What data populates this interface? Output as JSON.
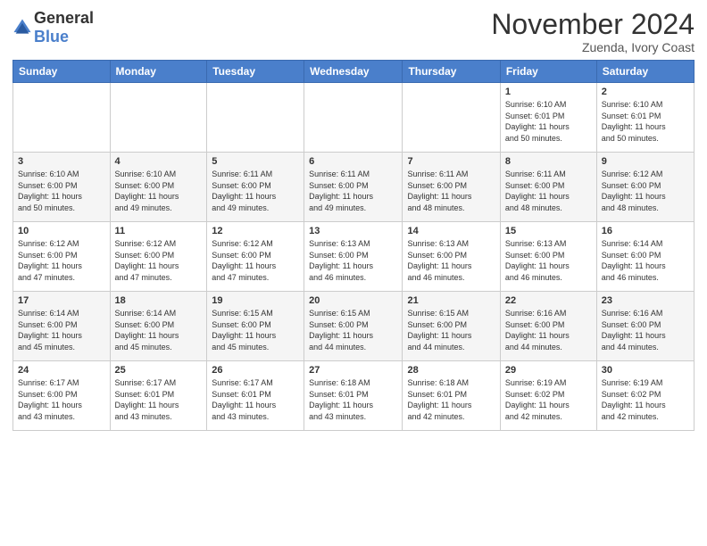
{
  "logo": {
    "general": "General",
    "blue": "Blue"
  },
  "header": {
    "month": "November 2024",
    "location": "Zuenda, Ivory Coast"
  },
  "weekdays": [
    "Sunday",
    "Monday",
    "Tuesday",
    "Wednesday",
    "Thursday",
    "Friday",
    "Saturday"
  ],
  "weeks": [
    [
      {
        "day": "",
        "info": ""
      },
      {
        "day": "",
        "info": ""
      },
      {
        "day": "",
        "info": ""
      },
      {
        "day": "",
        "info": ""
      },
      {
        "day": "",
        "info": ""
      },
      {
        "day": "1",
        "info": "Sunrise: 6:10 AM\nSunset: 6:01 PM\nDaylight: 11 hours\nand 50 minutes."
      },
      {
        "day": "2",
        "info": "Sunrise: 6:10 AM\nSunset: 6:01 PM\nDaylight: 11 hours\nand 50 minutes."
      }
    ],
    [
      {
        "day": "3",
        "info": "Sunrise: 6:10 AM\nSunset: 6:00 PM\nDaylight: 11 hours\nand 50 minutes."
      },
      {
        "day": "4",
        "info": "Sunrise: 6:10 AM\nSunset: 6:00 PM\nDaylight: 11 hours\nand 49 minutes."
      },
      {
        "day": "5",
        "info": "Sunrise: 6:11 AM\nSunset: 6:00 PM\nDaylight: 11 hours\nand 49 minutes."
      },
      {
        "day": "6",
        "info": "Sunrise: 6:11 AM\nSunset: 6:00 PM\nDaylight: 11 hours\nand 49 minutes."
      },
      {
        "day": "7",
        "info": "Sunrise: 6:11 AM\nSunset: 6:00 PM\nDaylight: 11 hours\nand 48 minutes."
      },
      {
        "day": "8",
        "info": "Sunrise: 6:11 AM\nSunset: 6:00 PM\nDaylight: 11 hours\nand 48 minutes."
      },
      {
        "day": "9",
        "info": "Sunrise: 6:12 AM\nSunset: 6:00 PM\nDaylight: 11 hours\nand 48 minutes."
      }
    ],
    [
      {
        "day": "10",
        "info": "Sunrise: 6:12 AM\nSunset: 6:00 PM\nDaylight: 11 hours\nand 47 minutes."
      },
      {
        "day": "11",
        "info": "Sunrise: 6:12 AM\nSunset: 6:00 PM\nDaylight: 11 hours\nand 47 minutes."
      },
      {
        "day": "12",
        "info": "Sunrise: 6:12 AM\nSunset: 6:00 PM\nDaylight: 11 hours\nand 47 minutes."
      },
      {
        "day": "13",
        "info": "Sunrise: 6:13 AM\nSunset: 6:00 PM\nDaylight: 11 hours\nand 46 minutes."
      },
      {
        "day": "14",
        "info": "Sunrise: 6:13 AM\nSunset: 6:00 PM\nDaylight: 11 hours\nand 46 minutes."
      },
      {
        "day": "15",
        "info": "Sunrise: 6:13 AM\nSunset: 6:00 PM\nDaylight: 11 hours\nand 46 minutes."
      },
      {
        "day": "16",
        "info": "Sunrise: 6:14 AM\nSunset: 6:00 PM\nDaylight: 11 hours\nand 46 minutes."
      }
    ],
    [
      {
        "day": "17",
        "info": "Sunrise: 6:14 AM\nSunset: 6:00 PM\nDaylight: 11 hours\nand 45 minutes."
      },
      {
        "day": "18",
        "info": "Sunrise: 6:14 AM\nSunset: 6:00 PM\nDaylight: 11 hours\nand 45 minutes."
      },
      {
        "day": "19",
        "info": "Sunrise: 6:15 AM\nSunset: 6:00 PM\nDaylight: 11 hours\nand 45 minutes."
      },
      {
        "day": "20",
        "info": "Sunrise: 6:15 AM\nSunset: 6:00 PM\nDaylight: 11 hours\nand 44 minutes."
      },
      {
        "day": "21",
        "info": "Sunrise: 6:15 AM\nSunset: 6:00 PM\nDaylight: 11 hours\nand 44 minutes."
      },
      {
        "day": "22",
        "info": "Sunrise: 6:16 AM\nSunset: 6:00 PM\nDaylight: 11 hours\nand 44 minutes."
      },
      {
        "day": "23",
        "info": "Sunrise: 6:16 AM\nSunset: 6:00 PM\nDaylight: 11 hours\nand 44 minutes."
      }
    ],
    [
      {
        "day": "24",
        "info": "Sunrise: 6:17 AM\nSunset: 6:00 PM\nDaylight: 11 hours\nand 43 minutes."
      },
      {
        "day": "25",
        "info": "Sunrise: 6:17 AM\nSunset: 6:01 PM\nDaylight: 11 hours\nand 43 minutes."
      },
      {
        "day": "26",
        "info": "Sunrise: 6:17 AM\nSunset: 6:01 PM\nDaylight: 11 hours\nand 43 minutes."
      },
      {
        "day": "27",
        "info": "Sunrise: 6:18 AM\nSunset: 6:01 PM\nDaylight: 11 hours\nand 43 minutes."
      },
      {
        "day": "28",
        "info": "Sunrise: 6:18 AM\nSunset: 6:01 PM\nDaylight: 11 hours\nand 42 minutes."
      },
      {
        "day": "29",
        "info": "Sunrise: 6:19 AM\nSunset: 6:02 PM\nDaylight: 11 hours\nand 42 minutes."
      },
      {
        "day": "30",
        "info": "Sunrise: 6:19 AM\nSunset: 6:02 PM\nDaylight: 11 hours\nand 42 minutes."
      }
    ]
  ]
}
